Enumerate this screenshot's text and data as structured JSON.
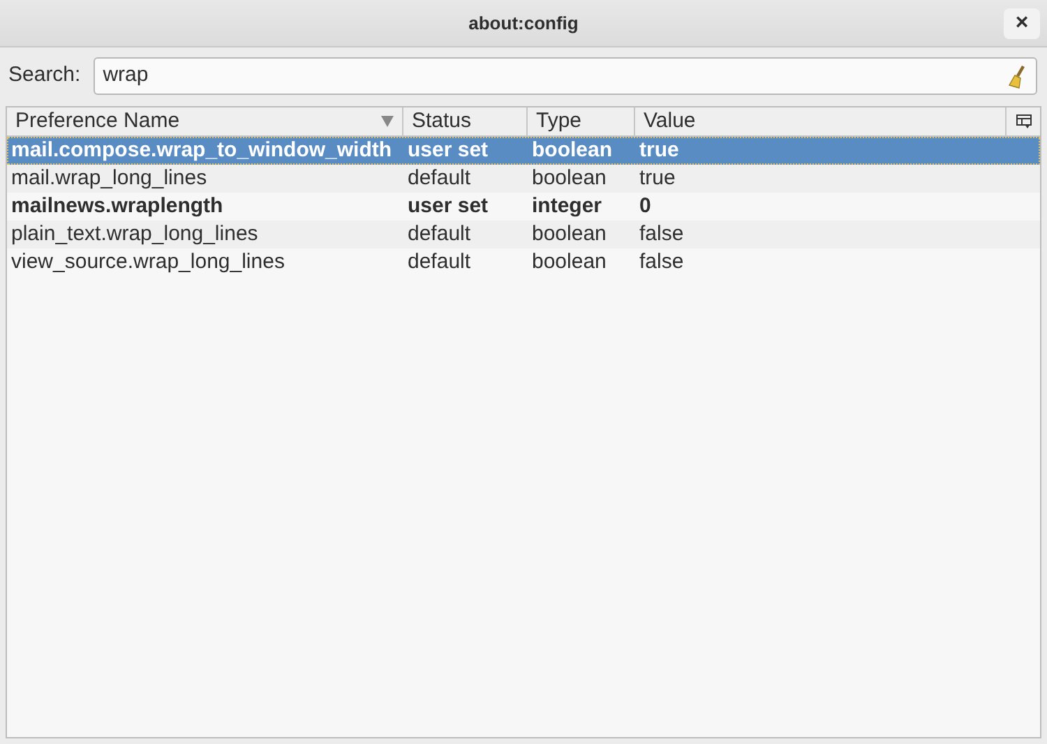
{
  "window": {
    "title": "about:config",
    "close": "×"
  },
  "search": {
    "label": "Search:",
    "value": "wrap"
  },
  "table": {
    "columns": [
      {
        "label": "Preference Name",
        "sorted": true
      },
      {
        "label": "Status",
        "sorted": false
      },
      {
        "label": "Type",
        "sorted": false
      },
      {
        "label": "Value",
        "sorted": false
      }
    ],
    "rows": [
      {
        "cells": [
          "mail.compose.wrap_to_window_width",
          "user set",
          "boolean",
          "true"
        ],
        "modified": true,
        "selected": true
      },
      {
        "cells": [
          "mail.wrap_long_lines",
          "default",
          "boolean",
          "true"
        ],
        "modified": false,
        "selected": false
      },
      {
        "cells": [
          "mailnews.wraplength",
          "user set",
          "integer",
          "0"
        ],
        "modified": true,
        "selected": false
      },
      {
        "cells": [
          "plain_text.wrap_long_lines",
          "default",
          "boolean",
          "false"
        ],
        "modified": false,
        "selected": false
      },
      {
        "cells": [
          "view_source.wrap_long_lines",
          "default",
          "boolean",
          "false"
        ],
        "modified": false,
        "selected": false
      }
    ]
  }
}
